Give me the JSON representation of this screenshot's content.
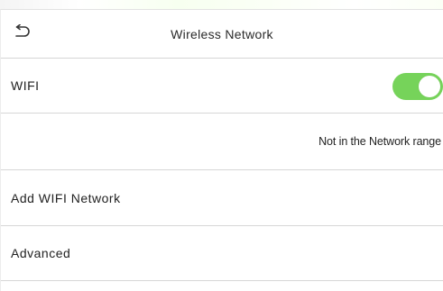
{
  "header": {
    "title": "Wireless Network",
    "back_icon": "back-arrow-icon"
  },
  "wifi": {
    "label": "WIFI",
    "enabled": true,
    "toggle_color": "#76d35a"
  },
  "status": {
    "text": "Not in the Network range"
  },
  "menu": {
    "add_label": "Add WIFI Network",
    "advanced_label": "Advanced"
  }
}
